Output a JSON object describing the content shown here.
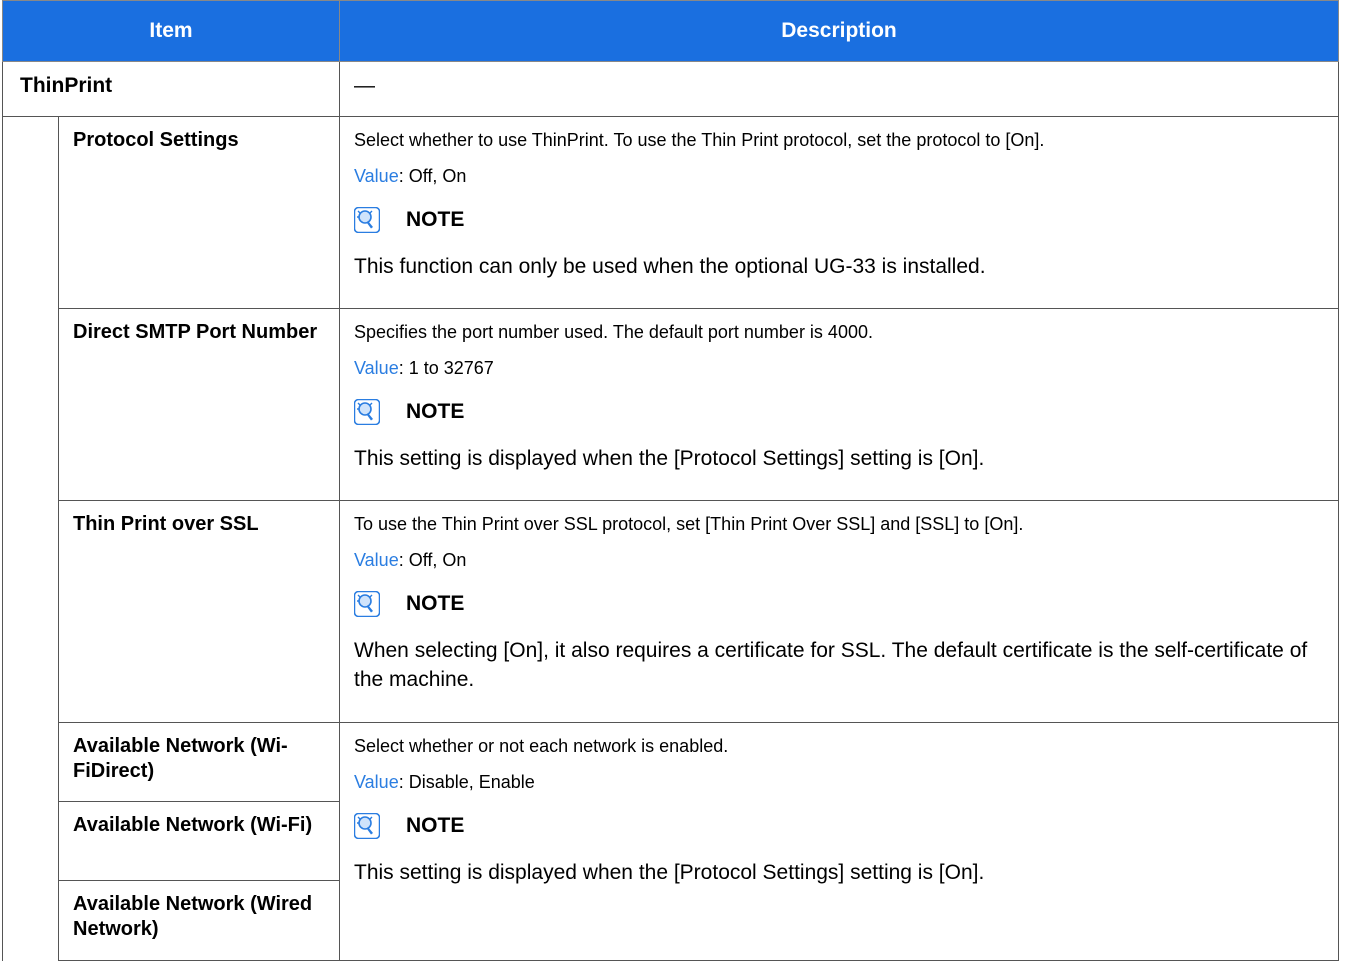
{
  "table": {
    "header": {
      "item": "Item",
      "description": "Description"
    },
    "group": {
      "name": "ThinPrint",
      "description": "—"
    },
    "rows": [
      {
        "item": "Protocol Settings",
        "description": "Select whether to use ThinPrint. To use the Thin Print protocol, set the protocol to [On].",
        "value_label": "Value",
        "value": ": Off, On",
        "note_label": "NOTE",
        "note": "This function can only be used when the optional UG-33 is installed."
      },
      {
        "item": "Direct SMTP Port Number",
        "description": "Specifies the port number used. The default port number is 4000.",
        "value_label": "Value",
        "value": ": 1 to 32767",
        "note_label": "NOTE",
        "note": "This setting is displayed when the [Protocol Settings] setting is [On]."
      },
      {
        "item": "Thin Print over SSL",
        "description": "To use the Thin Print over SSL protocol, set [Thin Print Over SSL] and [SSL] to [On].",
        "value_label": "Value",
        "value": ": Off, On",
        "note_label": "NOTE",
        "note": "When selecting [On], it also requires a certificate for SSL. The default certificate is the self-certificate of the machine."
      }
    ],
    "network": {
      "items": [
        "Available Network (Wi-FiDirect)",
        "Available Network (Wi-Fi)",
        "Available Network (Wired Network)"
      ],
      "description": "Select whether or not each network is enabled.",
      "value_label": "Value",
      "value": ": Disable, Enable",
      "note_label": "NOTE",
      "note": "This setting is displayed when the [Protocol Settings] setting is [On]."
    }
  },
  "colors": {
    "header_bg": "#1a6fe0",
    "value_label": "#2a7de1",
    "note_icon": "#2a7de1"
  }
}
